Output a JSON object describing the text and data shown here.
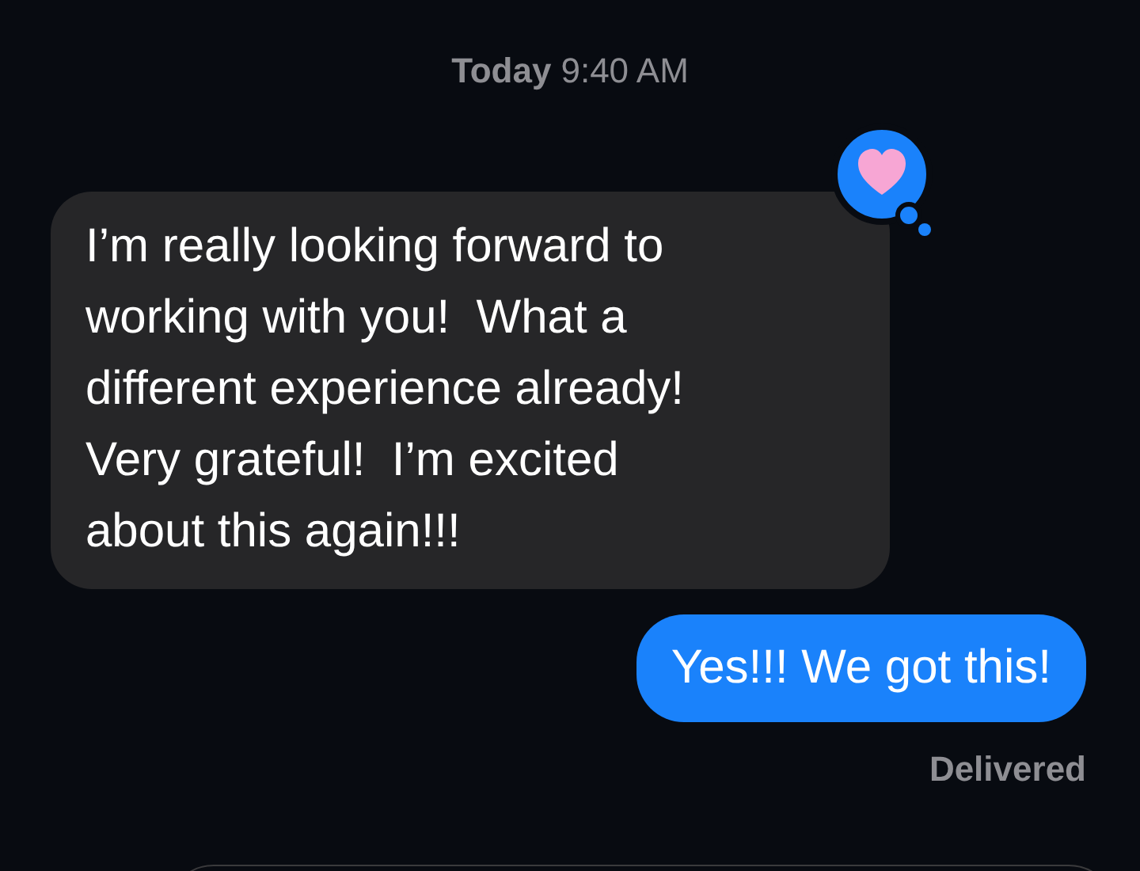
{
  "timestamp": {
    "day": "Today",
    "time": "9:40 AM"
  },
  "messages": [
    {
      "kind": "incoming",
      "text": "I’m really looking forward to\nworking with you!  What a\ndifferent experience already!\nVery grateful!  I’m excited\nabout this again!!!",
      "reaction": {
        "kind": "heart"
      }
    },
    {
      "kind": "outgoing",
      "text": "Yes!!! We got this!"
    }
  ],
  "status": "Delivered"
}
